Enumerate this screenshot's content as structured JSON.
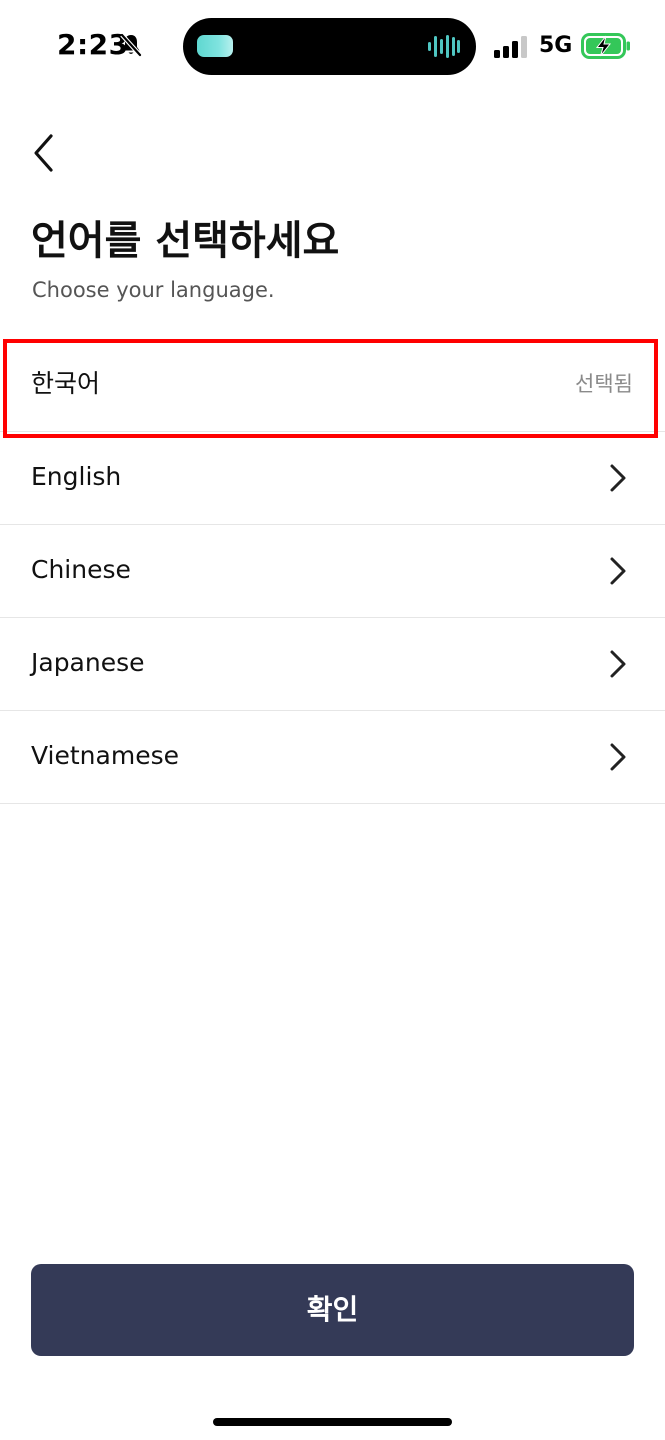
{
  "status_bar": {
    "time": "2:23",
    "network": "5G",
    "icons": [
      "bell-muted-icon",
      "signal-icon",
      "battery-charging-icon"
    ]
  },
  "header": {
    "back_icon": "chevron-left-icon",
    "title": "언어를 선택하세요",
    "subtitle": "Choose your language."
  },
  "languages": [
    {
      "label": "한국어",
      "status": "선택됨",
      "selected": true
    },
    {
      "label": "English",
      "icon": "chevron-right-icon"
    },
    {
      "label": "Chinese",
      "icon": "chevron-right-icon"
    },
    {
      "label": "Japanese",
      "icon": "chevron-right-icon"
    },
    {
      "label": "Vietnamese",
      "icon": "chevron-right-icon"
    }
  ],
  "footer": {
    "confirm_label": "확인"
  },
  "colors": {
    "button_bg": "#343a57",
    "highlight_border": "#ff0000",
    "battery_green": "#34c759"
  }
}
